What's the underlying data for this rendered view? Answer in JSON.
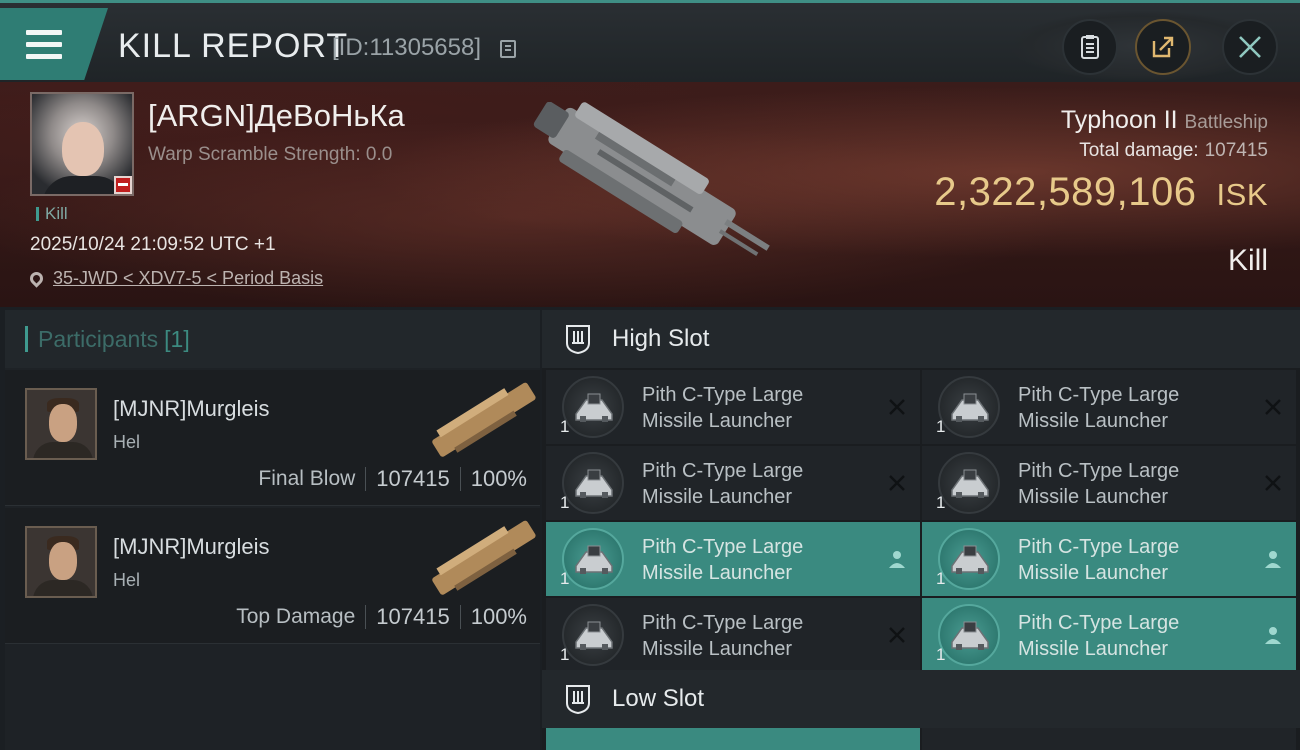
{
  "header": {
    "title": "KILL REPORT",
    "report_id": "[ID:11305658]"
  },
  "victim": {
    "name": "[ARGN]ДеВоНьКа",
    "scramble": "Warp Scramble Strength: 0.0",
    "result_tag": "Kill",
    "timestamp": "2025/10/24 21:09:52 UTC +1",
    "location": "35-JWD < XDV7-5 < Period Basis",
    "ship_name": "Typhoon II",
    "ship_class": "Battleship",
    "total_damage_label": "Total damage:",
    "total_damage": "107415",
    "isk_value": "2,322,589,106",
    "isk_unit": "ISK",
    "kill_label": "Kill"
  },
  "participants": {
    "label": "Participants",
    "count": "[1]",
    "rows": [
      {
        "name": "[MJNR]Murgleis",
        "ship": "Hel",
        "tag": "Final Blow",
        "damage": "107415",
        "percent": "100%"
      },
      {
        "name": "[MJNR]Murgleis",
        "ship": "Hel",
        "tag": "Top Damage",
        "damage": "107415",
        "percent": "100%"
      }
    ]
  },
  "slots": {
    "high_label": "High Slot",
    "low_label": "Low Slot",
    "high_modules": [
      {
        "name_line1": "Pith C-Type Large",
        "name_line2": "Missile Launcher",
        "qty": "1",
        "status": "destroyed"
      },
      {
        "name_line1": "Pith C-Type Large",
        "name_line2": "Missile Launcher",
        "qty": "1",
        "status": "destroyed"
      },
      {
        "name_line1": "Pith C-Type Large",
        "name_line2": "Missile Launcher",
        "qty": "1",
        "status": "destroyed"
      },
      {
        "name_line1": "Pith C-Type Large",
        "name_line2": "Missile Launcher",
        "qty": "1",
        "status": "destroyed"
      },
      {
        "name_line1": "Pith C-Type Large",
        "name_line2": "Missile Launcher",
        "qty": "1",
        "status": "dropped"
      },
      {
        "name_line1": "Pith C-Type Large",
        "name_line2": "Missile Launcher",
        "qty": "1",
        "status": "dropped"
      },
      {
        "name_line1": "Pith C-Type Large",
        "name_line2": "Missile Launcher",
        "qty": "1",
        "status": "destroyed"
      },
      {
        "name_line1": "Pith C-Type Large",
        "name_line2": "Missile Launcher",
        "qty": "1",
        "status": "dropped"
      }
    ]
  },
  "icons": {
    "menu": "hamburger-icon",
    "copy": "copy-icon",
    "clipboard": "clipboard-icon",
    "share": "share-icon",
    "close": "close-icon",
    "location": "location-pin-icon",
    "destroyed": "x-icon",
    "dropped": "person-icon"
  },
  "colors": {
    "accent": "#3f9a8f",
    "dropped_bg": "#3a8a80",
    "isk": "#e7c98a",
    "corp_badge": "#c01e1e"
  }
}
